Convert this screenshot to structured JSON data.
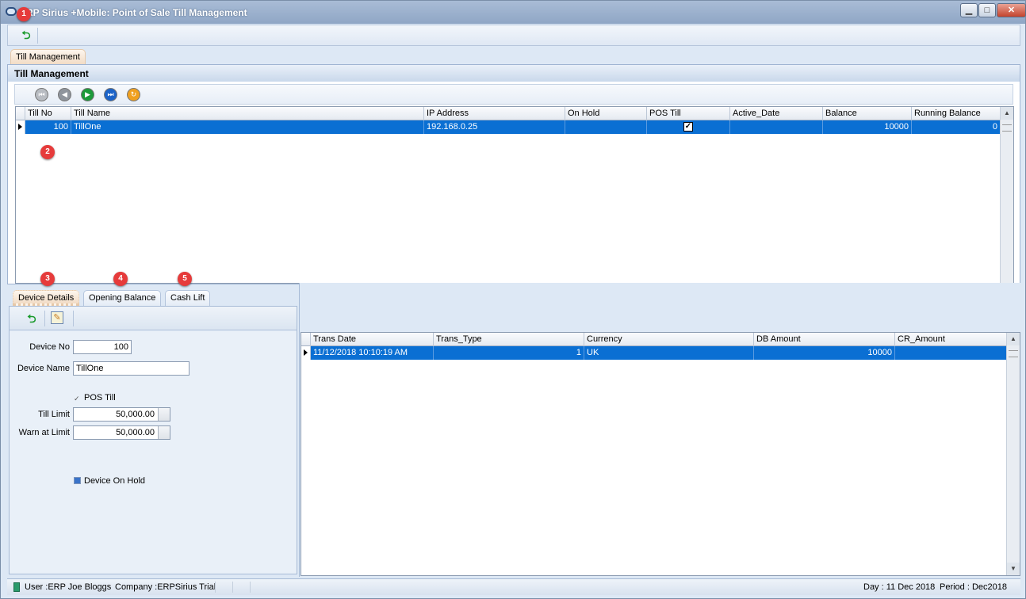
{
  "window": {
    "title": "ERP Sirius +Mobile: Point of Sale Till Management",
    "buttons": {
      "minimize": "▁",
      "maximize": "□",
      "close": "✕"
    }
  },
  "badges": [
    "1",
    "2",
    "3",
    "4",
    "5"
  ],
  "document_tab": "Till Management",
  "panel": {
    "title": "Till Management",
    "nav_buttons": [
      "first-icon",
      "prev-icon",
      "next-icon",
      "last-icon",
      "refresh-icon"
    ]
  },
  "tills_grid": {
    "columns": [
      "Till No",
      "Till Name",
      "IP Address",
      "On Hold",
      "POS Till",
      "Active_Date",
      "Balance",
      "Running Balance"
    ],
    "rows": [
      {
        "till_no": "100",
        "till_name": "TillOne",
        "ip": "192.168.0.25",
        "on_hold": "",
        "pos_till": "✓",
        "active_date": "",
        "balance": "10000",
        "running_balance": "0"
      }
    ]
  },
  "tabs": [
    "Device Details",
    "Opening Balance",
    "Cash Lift"
  ],
  "device": {
    "device_no_label": "Device No",
    "device_no": "100",
    "device_name_label": "Device Name",
    "device_name": "TillOne",
    "pos_till_label": "POS Till",
    "pos_till_mark": "✓",
    "till_limit_label": "Till Limit",
    "till_limit": "50,000.00",
    "warn_label": "Warn at Limit",
    "warn_limit": "50,000.00",
    "on_hold_label": "Device On Hold"
  },
  "trans_grid": {
    "columns": [
      "Trans Date",
      "Trans_Type",
      "Currency",
      "DB Amount",
      "CR_Amount"
    ],
    "rows": [
      {
        "trans_date": "11/12/2018 10:10:19 AM",
        "trans_type": "1",
        "currency": "UK",
        "db_amount": "10000",
        "cr_amount": ""
      }
    ]
  },
  "status": {
    "user": "User :ERP Joe Bloggs",
    "company": "Company :ERPSirius Trial",
    "day": "Day : 11 Dec 2018",
    "period": "Period : Dec2018"
  },
  "colors": {
    "selection": "#0a6fd3",
    "badge": "#e63b3b",
    "accent_tab": "#f2dcc5"
  }
}
